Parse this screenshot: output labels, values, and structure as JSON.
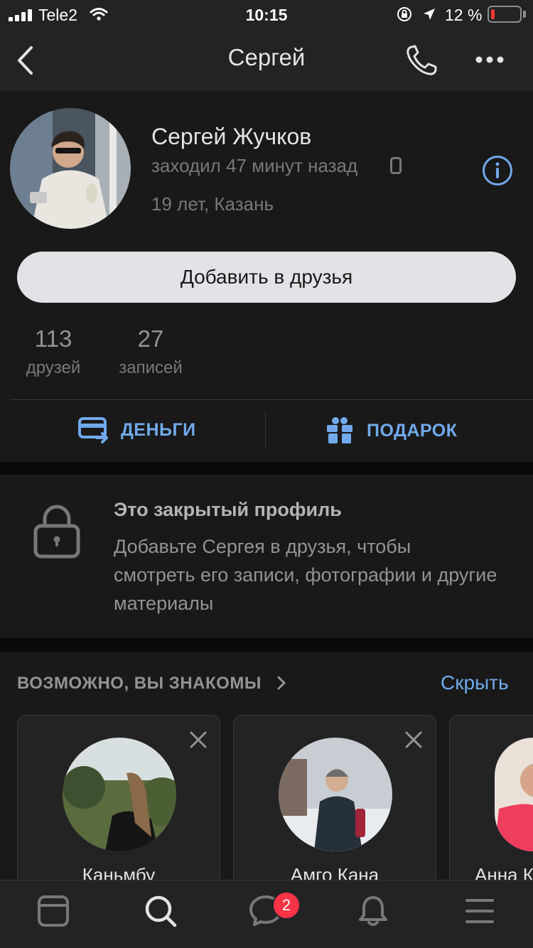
{
  "status_bar": {
    "carrier": "Tele2",
    "time": "10:15",
    "battery_percent_label": "12 %",
    "battery_level": 0.12
  },
  "nav": {
    "title": "Сергей"
  },
  "profile": {
    "name": "Сергей Жучков",
    "last_seen": "заходил 47 минут назад",
    "info": "19 лет, Казань",
    "add_button": "Добавить в друзья",
    "counters": [
      {
        "value": "113",
        "label": "друзей"
      },
      {
        "value": "27",
        "label": "записей"
      }
    ],
    "actions": {
      "money": "ДЕНЬГИ",
      "gift": "ПОДАРОК"
    }
  },
  "closed_profile": {
    "title": "Это закрытый профиль",
    "text": "Добавьте Сергея в друзья, чтобы смотреть его записи, фотографии и другие материалы"
  },
  "suggestions": {
    "header": "ВОЗМОЖНО, ВЫ ЗНАКОМЫ",
    "hide_label": "Скрыть",
    "cards": [
      {
        "name": "Каньмбу"
      },
      {
        "name": "Амго Кана"
      },
      {
        "name": "Анна К"
      }
    ]
  },
  "tabbar": {
    "messages_badge": "2"
  },
  "colors": {
    "accent": "#71aaeb",
    "background": "#19191a",
    "bar": "#232324",
    "badge": "#ff3347"
  },
  "icons": [
    "back-arrow-icon",
    "phone-icon",
    "more-icon",
    "info-icon",
    "phone-device-icon",
    "wallet-icon",
    "gift-icon",
    "lock-icon",
    "chevron-right-icon",
    "close-icon",
    "news-icon",
    "search-icon",
    "messages-icon",
    "bell-icon",
    "menu-icon"
  ]
}
